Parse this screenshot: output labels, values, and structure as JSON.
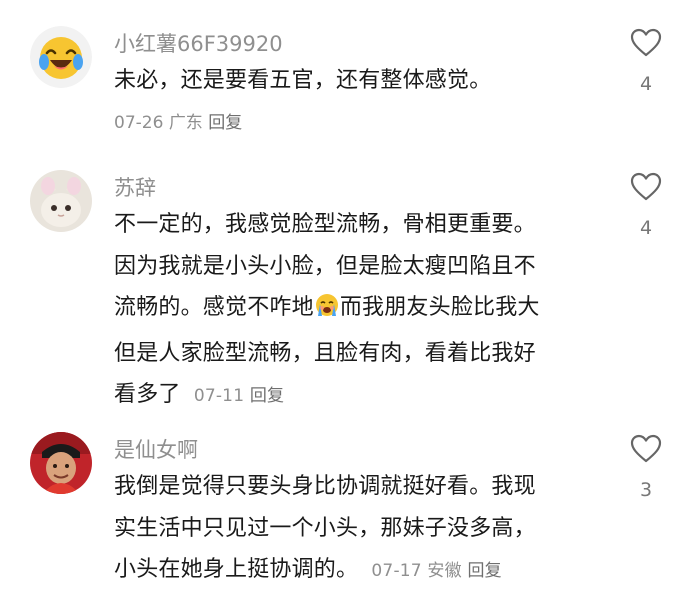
{
  "comments": [
    {
      "username": "小红薯66F39920",
      "lines": [
        "未必，还是要看五官，还有整体感觉。"
      ],
      "date": "07-26",
      "location": "广东",
      "reply_label": "回复",
      "likes": "4",
      "avatar_icon": "laughing-emoji-avatar"
    },
    {
      "username": "苏辞",
      "lines": [
        "不一定的，我感觉脸型流畅，骨相更重要。",
        "因为我就是小头小脸，但是脸太瘦凹陷且不",
        "流畅的。感觉不咋地",
        "而我朋友头脸比我大",
        "但是人家脸型流畅，且脸有肉，看着比我好",
        "看多了"
      ],
      "date": "07-11",
      "location": "",
      "reply_label": "回复",
      "likes": "4",
      "avatar_icon": "cat-photo-avatar",
      "inline_emoji": "crying-emoji-icon"
    },
    {
      "username": "是仙女啊",
      "lines": [
        "我倒是觉得只要头身比协调就挺好看。我现",
        "实生活中只见过一个小头，那妹子没多高，",
        "小头在她身上挺协调的。"
      ],
      "date": "07-17",
      "location": "安徽",
      "reply_label": "回复",
      "likes": "3",
      "avatar_icon": "man-photo-avatar"
    }
  ],
  "colors": {
    "text": "#1a1a1a",
    "meta": "#8f8f8f",
    "like_outline": "#666666",
    "emoji_yellow": "#f7c531"
  }
}
